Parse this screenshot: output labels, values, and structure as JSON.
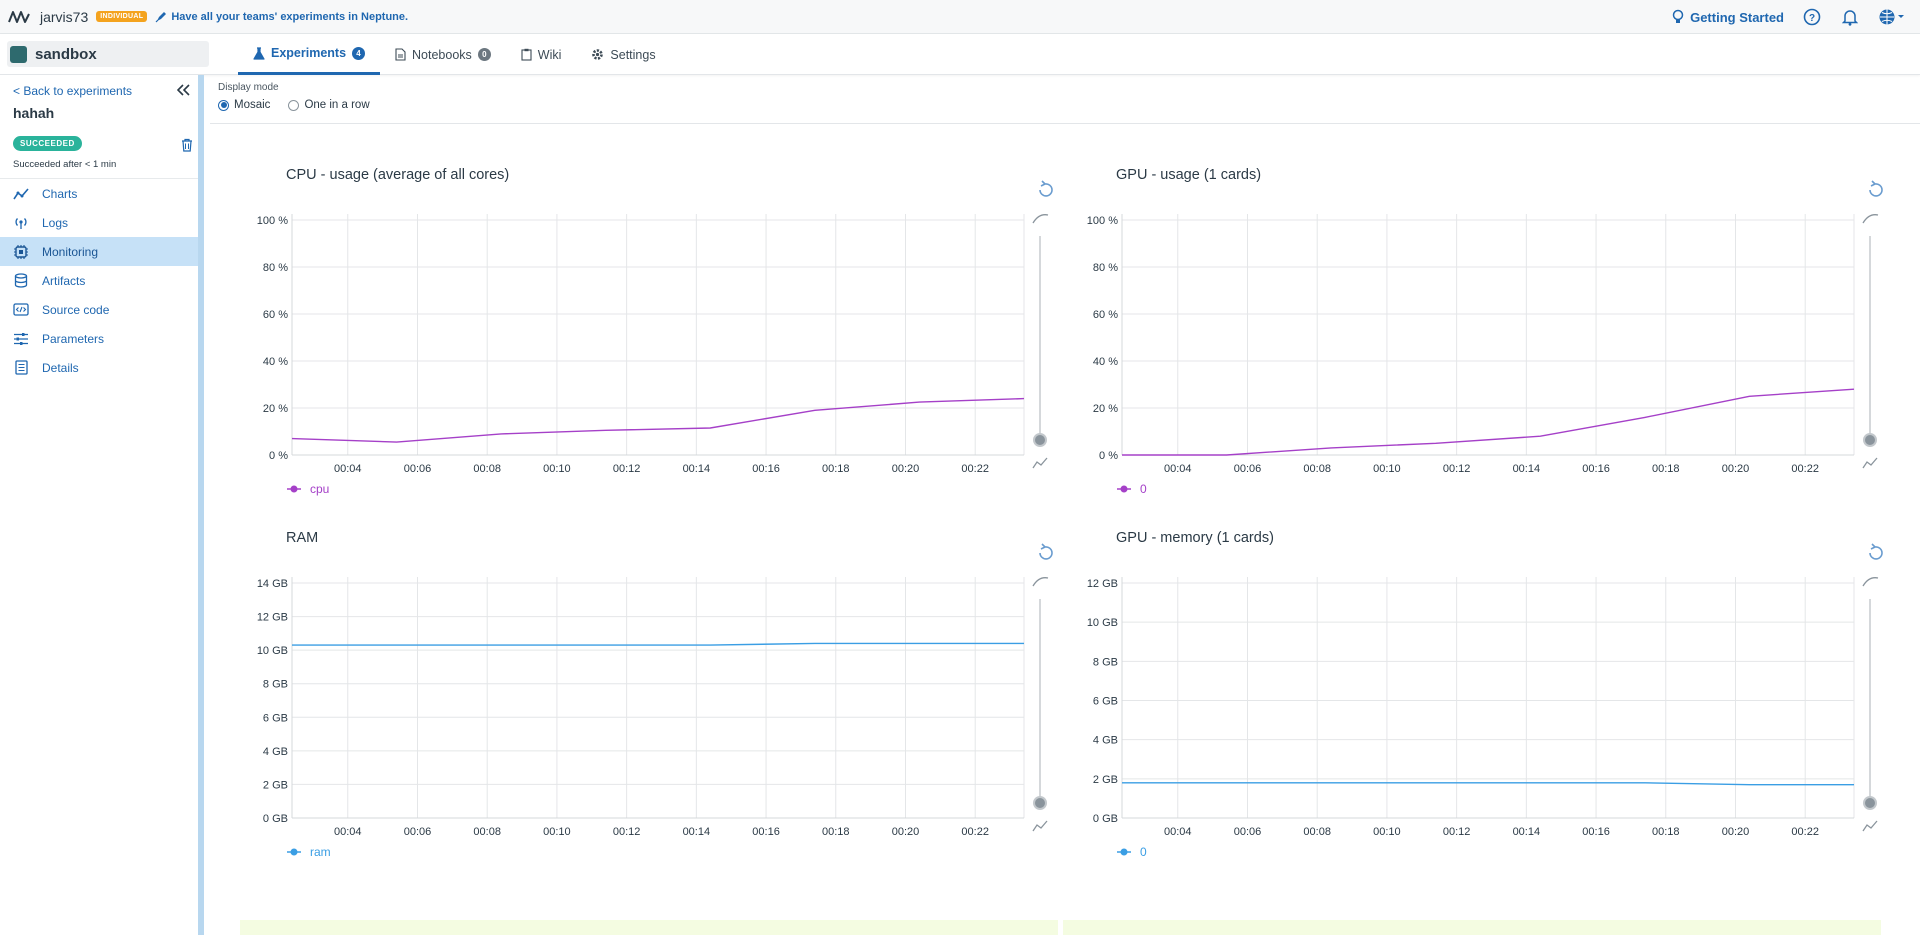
{
  "topbar": {
    "user": "jarvis73",
    "badge": "INDIVIDUAL",
    "promo": "Have all your teams' experiments in Neptune.",
    "getting_started": "Getting Started"
  },
  "project": {
    "name": "sandbox"
  },
  "tabs": [
    {
      "label": "Experiments",
      "count": "4"
    },
    {
      "label": "Notebooks",
      "count": "0"
    },
    {
      "label": "Wiki"
    },
    {
      "label": "Settings"
    }
  ],
  "sidebar": {
    "back": "< Back to experiments",
    "experiment": "hahah",
    "status": "SUCCEEDED",
    "status_text": "Succeeded after < 1 min",
    "items": [
      {
        "label": "Charts",
        "icon": "chart-line-icon"
      },
      {
        "label": "Logs",
        "icon": "broadcast-icon"
      },
      {
        "label": "Monitoring",
        "icon": "chip-icon"
      },
      {
        "label": "Artifacts",
        "icon": "database-icon"
      },
      {
        "label": "Source code",
        "icon": "code-icon"
      },
      {
        "label": "Parameters",
        "icon": "sliders-icon"
      },
      {
        "label": "Details",
        "icon": "document-icon"
      }
    ]
  },
  "display_mode": {
    "label": "Display mode",
    "options": [
      "Mosaic",
      "One in a row"
    ],
    "selected": "Mosaic"
  },
  "colors": {
    "cpu": "#a540c8",
    "mem": "#3a9ee4",
    "accent": "#1f67b0"
  },
  "chart_data": [
    {
      "type": "line",
      "title": "CPU - usage (average of all cores)",
      "x_ticks": [
        "00:04",
        "00:06",
        "00:08",
        "00:10",
        "00:12",
        "00:14",
        "00:16",
        "00:18",
        "00:20",
        "00:22"
      ],
      "y_ticks": [
        "0 %",
        "20 %",
        "40 %",
        "60 %",
        "80 %",
        "100 %"
      ],
      "ylim": [
        0,
        100
      ],
      "xlim": [
        2.4,
        23.4
      ],
      "series": [
        {
          "name": "cpu",
          "color": "#a540c8",
          "x": [
            2.4,
            5.4,
            8.4,
            11.4,
            14.4,
            17.4,
            20.4,
            23.4
          ],
          "y": [
            7,
            5.5,
            9,
            10.5,
            11.5,
            19,
            22.5,
            24
          ]
        }
      ]
    },
    {
      "type": "line",
      "title": "GPU - usage (1 cards)",
      "x_ticks": [
        "00:04",
        "00:06",
        "00:08",
        "00:10",
        "00:12",
        "00:14",
        "00:16",
        "00:18",
        "00:20",
        "00:22"
      ],
      "y_ticks": [
        "0 %",
        "20 %",
        "40 %",
        "60 %",
        "80 %",
        "100 %"
      ],
      "ylim": [
        0,
        100
      ],
      "xlim": [
        2.4,
        23.4
      ],
      "series": [
        {
          "name": "0",
          "color": "#a540c8",
          "x": [
            2.4,
            5.4,
            8.4,
            11.4,
            14.4,
            17.4,
            20.4,
            23.4
          ],
          "y": [
            0,
            0,
            3,
            5,
            8,
            16,
            25,
            28
          ]
        }
      ]
    },
    {
      "type": "line",
      "title": "RAM",
      "x_ticks": [
        "00:04",
        "00:06",
        "00:08",
        "00:10",
        "00:12",
        "00:14",
        "00:16",
        "00:18",
        "00:20",
        "00:22"
      ],
      "y_ticks": [
        "0 GB",
        "2 GB",
        "4 GB",
        "6 GB",
        "8 GB",
        "10 GB",
        "12 GB",
        "14 GB"
      ],
      "ylim": [
        0,
        14
      ],
      "xlim": [
        2.4,
        23.4
      ],
      "series": [
        {
          "name": "ram",
          "color": "#3a9ee4",
          "x": [
            2.4,
            5.4,
            8.4,
            11.4,
            14.4,
            17.4,
            20.4,
            23.4
          ],
          "y": [
            10.3,
            10.3,
            10.3,
            10.3,
            10.3,
            10.4,
            10.4,
            10.4
          ]
        }
      ]
    },
    {
      "type": "line",
      "title": "GPU - memory (1 cards)",
      "x_ticks": [
        "00:04",
        "00:06",
        "00:08",
        "00:10",
        "00:12",
        "00:14",
        "00:16",
        "00:18",
        "00:20",
        "00:22"
      ],
      "y_ticks": [
        "0 GB",
        "2 GB",
        "4 GB",
        "6 GB",
        "8 GB",
        "10 GB",
        "12 GB"
      ],
      "ylim": [
        0,
        12
      ],
      "xlim": [
        2.4,
        23.4
      ],
      "series": [
        {
          "name": "0",
          "color": "#3a9ee4",
          "x": [
            2.4,
            5.4,
            8.4,
            11.4,
            14.4,
            17.4,
            20.4,
            23.4
          ],
          "y": [
            1.8,
            1.8,
            1.8,
            1.8,
            1.8,
            1.8,
            1.7,
            1.7
          ]
        }
      ]
    }
  ]
}
